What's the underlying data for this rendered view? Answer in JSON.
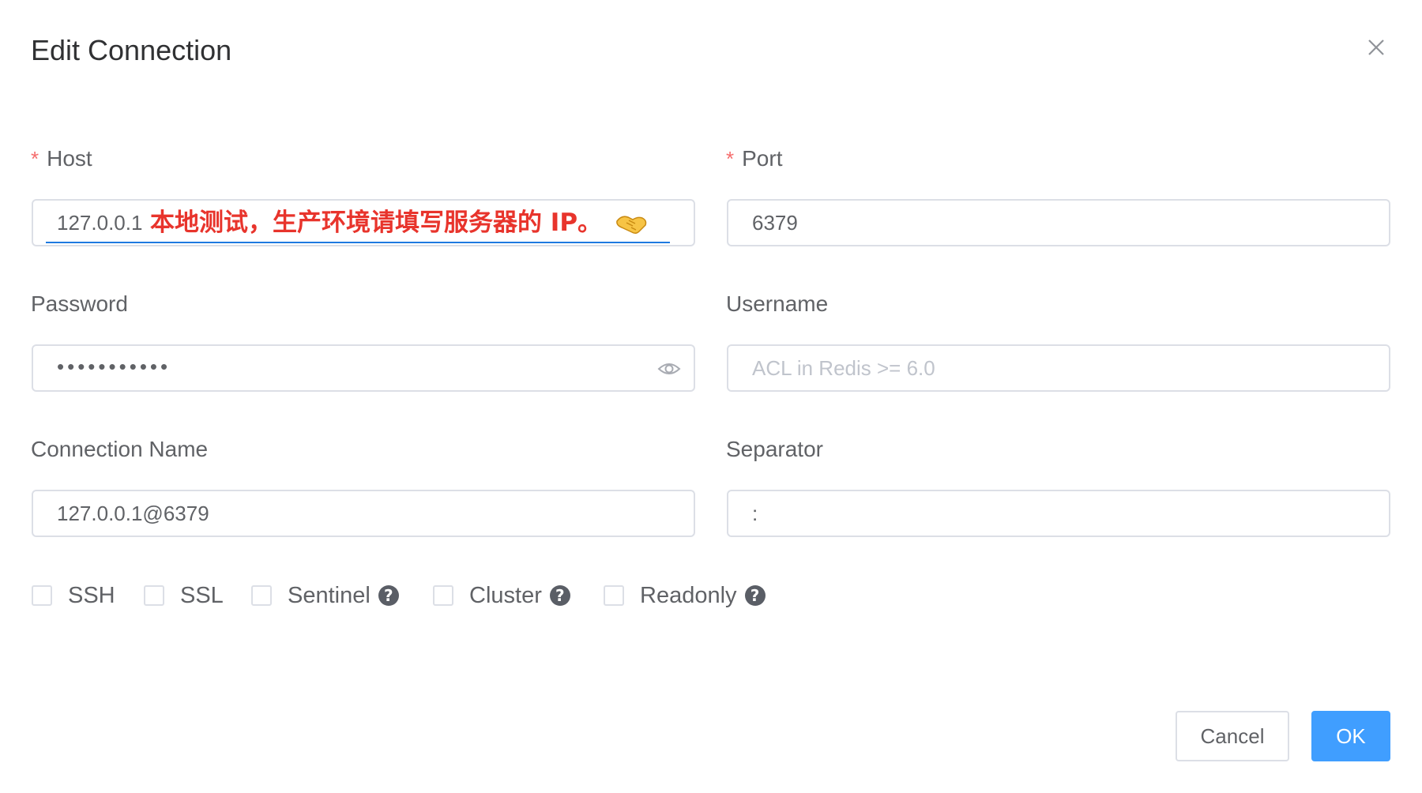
{
  "dialog": {
    "title": "Edit Connection"
  },
  "form": {
    "host": {
      "label": "Host",
      "required_mark": "*",
      "value": "127.0.0.1",
      "annotation": "本地测试，生产环境请填写服务器的 IP。"
    },
    "port": {
      "label": "Port",
      "required_mark": "*",
      "value": "6379"
    },
    "password": {
      "label": "Password",
      "masked_value": "•••••••••••"
    },
    "username": {
      "label": "Username",
      "placeholder": "ACL in Redis >= 6.0"
    },
    "connection_name": {
      "label": "Connection Name",
      "value": "127.0.0.1@6379"
    },
    "separator": {
      "label": "Separator",
      "value": ":"
    }
  },
  "options": [
    {
      "label": "SSH",
      "checked": false,
      "has_help": false
    },
    {
      "label": "SSL",
      "checked": false,
      "has_help": false
    },
    {
      "label": "Sentinel",
      "checked": false,
      "has_help": true
    },
    {
      "label": "Cluster",
      "checked": false,
      "has_help": true
    },
    {
      "label": "Readonly",
      "checked": false,
      "has_help": true
    }
  ],
  "help_glyph": "?",
  "buttons": {
    "cancel": "Cancel",
    "ok": "OK"
  },
  "colors": {
    "primary": "#409eff",
    "required": "#f56c6c",
    "annotation": "#e8342c"
  },
  "icons": {
    "close": "close-icon",
    "eye": "eye-icon",
    "help": "question-circle-icon",
    "handshake": "handshake-emoji"
  }
}
